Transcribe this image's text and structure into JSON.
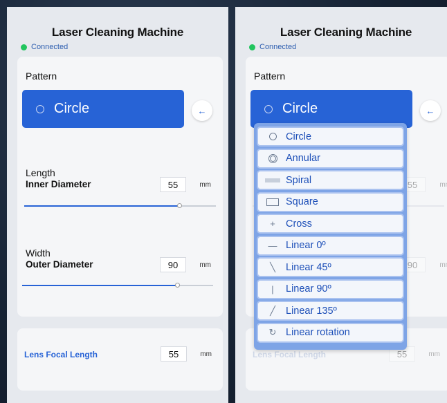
{
  "app": {
    "title": "Laser Cleaning Machine",
    "status": "Connected"
  },
  "pattern": {
    "label": "Pattern",
    "selected": "Circle",
    "back_icon": "←"
  },
  "length": {
    "label": "Length",
    "sublabel": "Inner Diameter",
    "value": "55",
    "unit": "mm",
    "level": 0.81
  },
  "width": {
    "label": "Width",
    "sublabel": "Outer Diameter",
    "value": "90",
    "unit": "mm",
    "level": 0.81
  },
  "lens": {
    "label": "Lens Focal Length",
    "value": "55",
    "unit": "mm"
  },
  "dropdown": {
    "options": [
      {
        "label": "Circle",
        "icon": "circle-icon"
      },
      {
        "label": "Annular",
        "icon": "annular-icon"
      },
      {
        "label": "Spiral",
        "icon": "spiral-icon"
      },
      {
        "label": "Square",
        "icon": "square-icon"
      },
      {
        "label": "Cross",
        "icon": "cross-icon",
        "glyph": "+"
      },
      {
        "label": "Linear 0º",
        "icon": "linear-0-icon",
        "glyph": "—"
      },
      {
        "label": "Linear 45º",
        "icon": "linear-45-icon",
        "glyph": "╲"
      },
      {
        "label": "Linear 90º",
        "icon": "linear-90-icon",
        "glyph": "|"
      },
      {
        "label": "Linear 135º",
        "icon": "linear-135-icon",
        "glyph": "╱"
      },
      {
        "label": "Linear rotation",
        "icon": "linear-rotation-icon",
        "glyph": "↻"
      }
    ]
  },
  "colors": {
    "accent": "#2763d6",
    "status": "#22c55e"
  }
}
